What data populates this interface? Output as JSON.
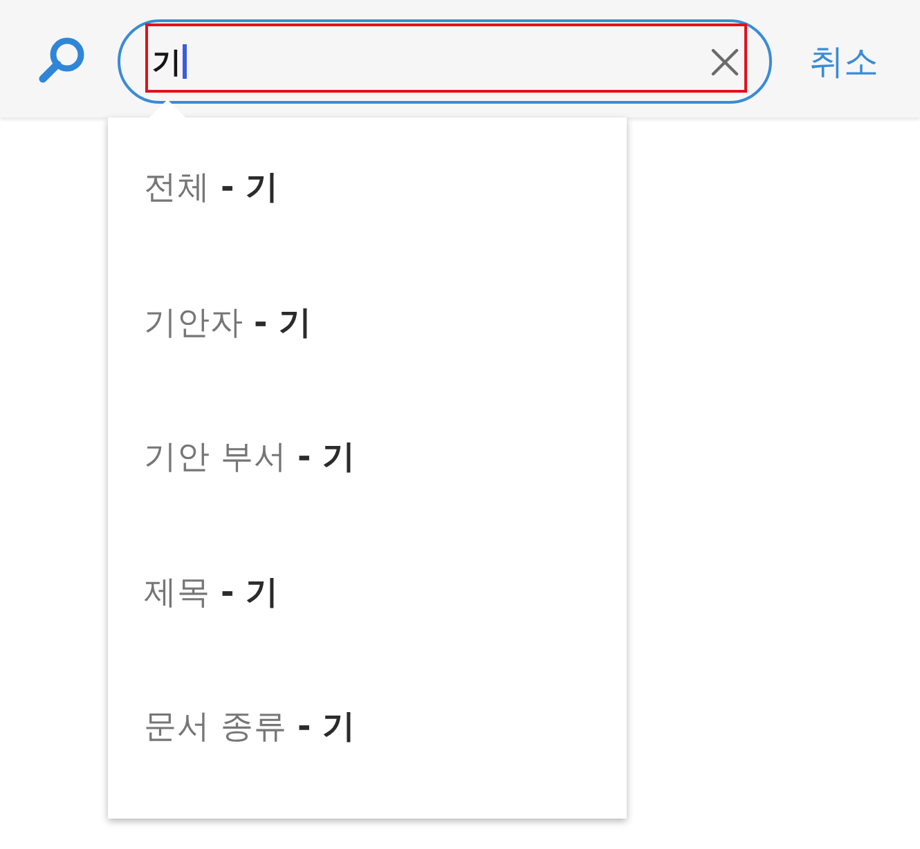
{
  "search": {
    "value": "기",
    "focused": true,
    "highlighted": true
  },
  "cancel_button": "취소",
  "suggestions": [
    {
      "text": "전체 **- 기**",
      "selected": false
    },
    {
      "text": "기안자 **- 기**",
      "selected": false
    },
    {
      "text": "기안 부서 **- 기**",
      "selected": false
    },
    {
      "text": "제목 **- 기**",
      "selected": false
    },
    {
      "text": "문서 종류 **- 기**",
      "selected": false
    }
  ]
}
